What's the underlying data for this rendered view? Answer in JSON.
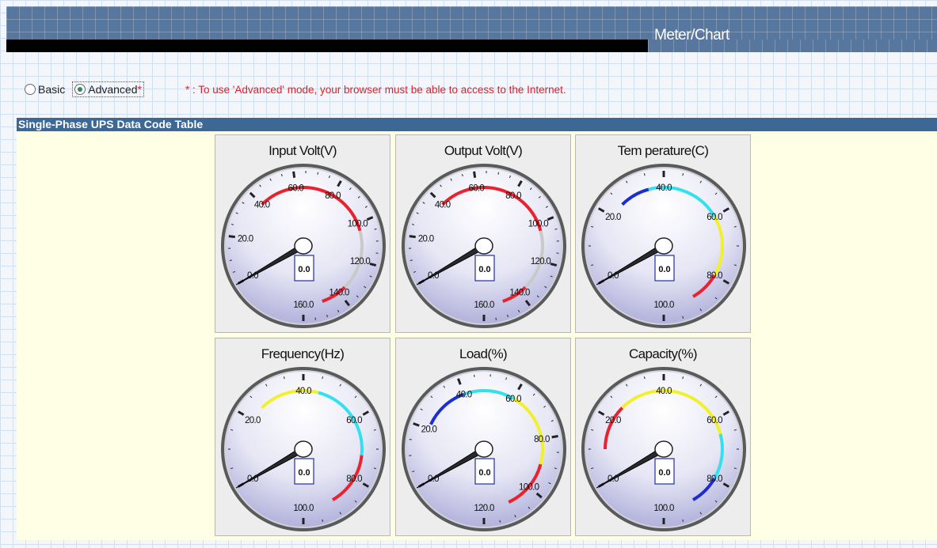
{
  "header": {
    "title": "Meter/Chart"
  },
  "mode": {
    "basic_label": "Basic",
    "advanced_label": "Advanced",
    "advanced_asterisk": "*",
    "selected": "advanced",
    "note": "* : To use 'Advanced' mode, your browser must be able to access to the Internet."
  },
  "table": {
    "title": "Single-Phase UPS Data Code Table"
  },
  "gauges": [
    {
      "title": "Input Volt(V)",
      "value": "0.0",
      "max": 160,
      "labels": [
        {
          "v": 0,
          "t": "0.0"
        },
        {
          "v": 20,
          "t": "20.0"
        },
        {
          "v": 40,
          "t": "40.0"
        },
        {
          "v": 60,
          "t": "60.0"
        },
        {
          "v": 80,
          "t": "80.0"
        },
        {
          "v": 100,
          "t": "100.0"
        },
        {
          "v": 120,
          "t": "120.0"
        },
        {
          "v": 140,
          "t": "140.0"
        },
        {
          "v": 160,
          "t": "160.0"
        }
      ],
      "arcs": [
        {
          "from": 40,
          "to": 104,
          "color": "#e8222e"
        },
        {
          "from": 104,
          "to": 136,
          "color": "#c9c9c9"
        },
        {
          "from": 136,
          "to": 150,
          "color": "#e8222e"
        }
      ]
    },
    {
      "title": "Output Volt(V)",
      "value": "0.0",
      "max": 160,
      "labels": [
        {
          "v": 0,
          "t": "0.0"
        },
        {
          "v": 20,
          "t": "20.0"
        },
        {
          "v": 40,
          "t": "40.0"
        },
        {
          "v": 60,
          "t": "60.0"
        },
        {
          "v": 80,
          "t": "80.0"
        },
        {
          "v": 100,
          "t": "100.0"
        },
        {
          "v": 120,
          "t": "120.0"
        },
        {
          "v": 140,
          "t": "140.0"
        },
        {
          "v": 160,
          "t": "160.0"
        }
      ],
      "arcs": [
        {
          "from": 40,
          "to": 104,
          "color": "#e8222e"
        },
        {
          "from": 104,
          "to": 136,
          "color": "#c9c9c9"
        },
        {
          "from": 136,
          "to": 150,
          "color": "#e8222e"
        }
      ]
    },
    {
      "title": "Tem perature(C)",
      "value": "0.0",
      "max": 100,
      "labels": [
        {
          "v": 0,
          "t": "0.0"
        },
        {
          "v": 20,
          "t": "20.0"
        },
        {
          "v": 40,
          "t": "40.0"
        },
        {
          "v": 60,
          "t": "60.0"
        },
        {
          "v": 80,
          "t": "80.0"
        },
        {
          "v": 100,
          "t": "100.0"
        }
      ],
      "arcs": [
        {
          "from": 25,
          "to": 35,
          "color": "#1b2fd0"
        },
        {
          "from": 35,
          "to": 60,
          "color": "#33e0f0"
        },
        {
          "from": 60,
          "to": 80,
          "color": "#f2f02c"
        },
        {
          "from": 80,
          "to": 90,
          "color": "#e8222e"
        }
      ]
    },
    {
      "title": "Frequency(Hz)",
      "value": "0.0",
      "max": 100,
      "labels": [
        {
          "v": 0,
          "t": "0.0"
        },
        {
          "v": 20,
          "t": "20.0"
        },
        {
          "v": 40,
          "t": "40.0"
        },
        {
          "v": 60,
          "t": "60.0"
        },
        {
          "v": 80,
          "t": "80.0"
        },
        {
          "v": 100,
          "t": "100.0"
        }
      ],
      "arcs": [
        {
          "from": 25,
          "to": 45,
          "color": "#f2f02c"
        },
        {
          "from": 45,
          "to": 72,
          "color": "#33e0f0"
        },
        {
          "from": 72,
          "to": 90,
          "color": "#e8222e"
        }
      ]
    },
    {
      "title": "Load(%)",
      "value": "0.0",
      "max": 120,
      "labels": [
        {
          "v": 0,
          "t": "0.0"
        },
        {
          "v": 20,
          "t": "20.0"
        },
        {
          "v": 40,
          "t": "40.0"
        },
        {
          "v": 60,
          "t": "60.0"
        },
        {
          "v": 80,
          "t": "80.0"
        },
        {
          "v": 100,
          "t": "100.0"
        },
        {
          "v": 120,
          "t": "120.0"
        }
      ],
      "arcs": [
        {
          "from": 22,
          "to": 40,
          "color": "#1b2fd0"
        },
        {
          "from": 40,
          "to": 60,
          "color": "#33e0f0"
        },
        {
          "from": 60,
          "to": 90,
          "color": "#f2f02c"
        },
        {
          "from": 90,
          "to": 110,
          "color": "#e8222e"
        }
      ]
    },
    {
      "title": "Capacity(%)",
      "value": "0.0",
      "max": 100,
      "labels": [
        {
          "v": 0,
          "t": "0.0"
        },
        {
          "v": 20,
          "t": "20.0"
        },
        {
          "v": 40,
          "t": "40.0"
        },
        {
          "v": 60,
          "t": "60.0"
        },
        {
          "v": 80,
          "t": "80.0"
        },
        {
          "v": 100,
          "t": "100.0"
        }
      ],
      "arcs": [
        {
          "from": 10,
          "to": 25,
          "color": "#e8222e"
        },
        {
          "from": 25,
          "to": 65,
          "color": "#f2f02c"
        },
        {
          "from": 65,
          "to": 80,
          "color": "#33e0f0"
        },
        {
          "from": 80,
          "to": 90,
          "color": "#1b2fd0"
        }
      ]
    }
  ]
}
